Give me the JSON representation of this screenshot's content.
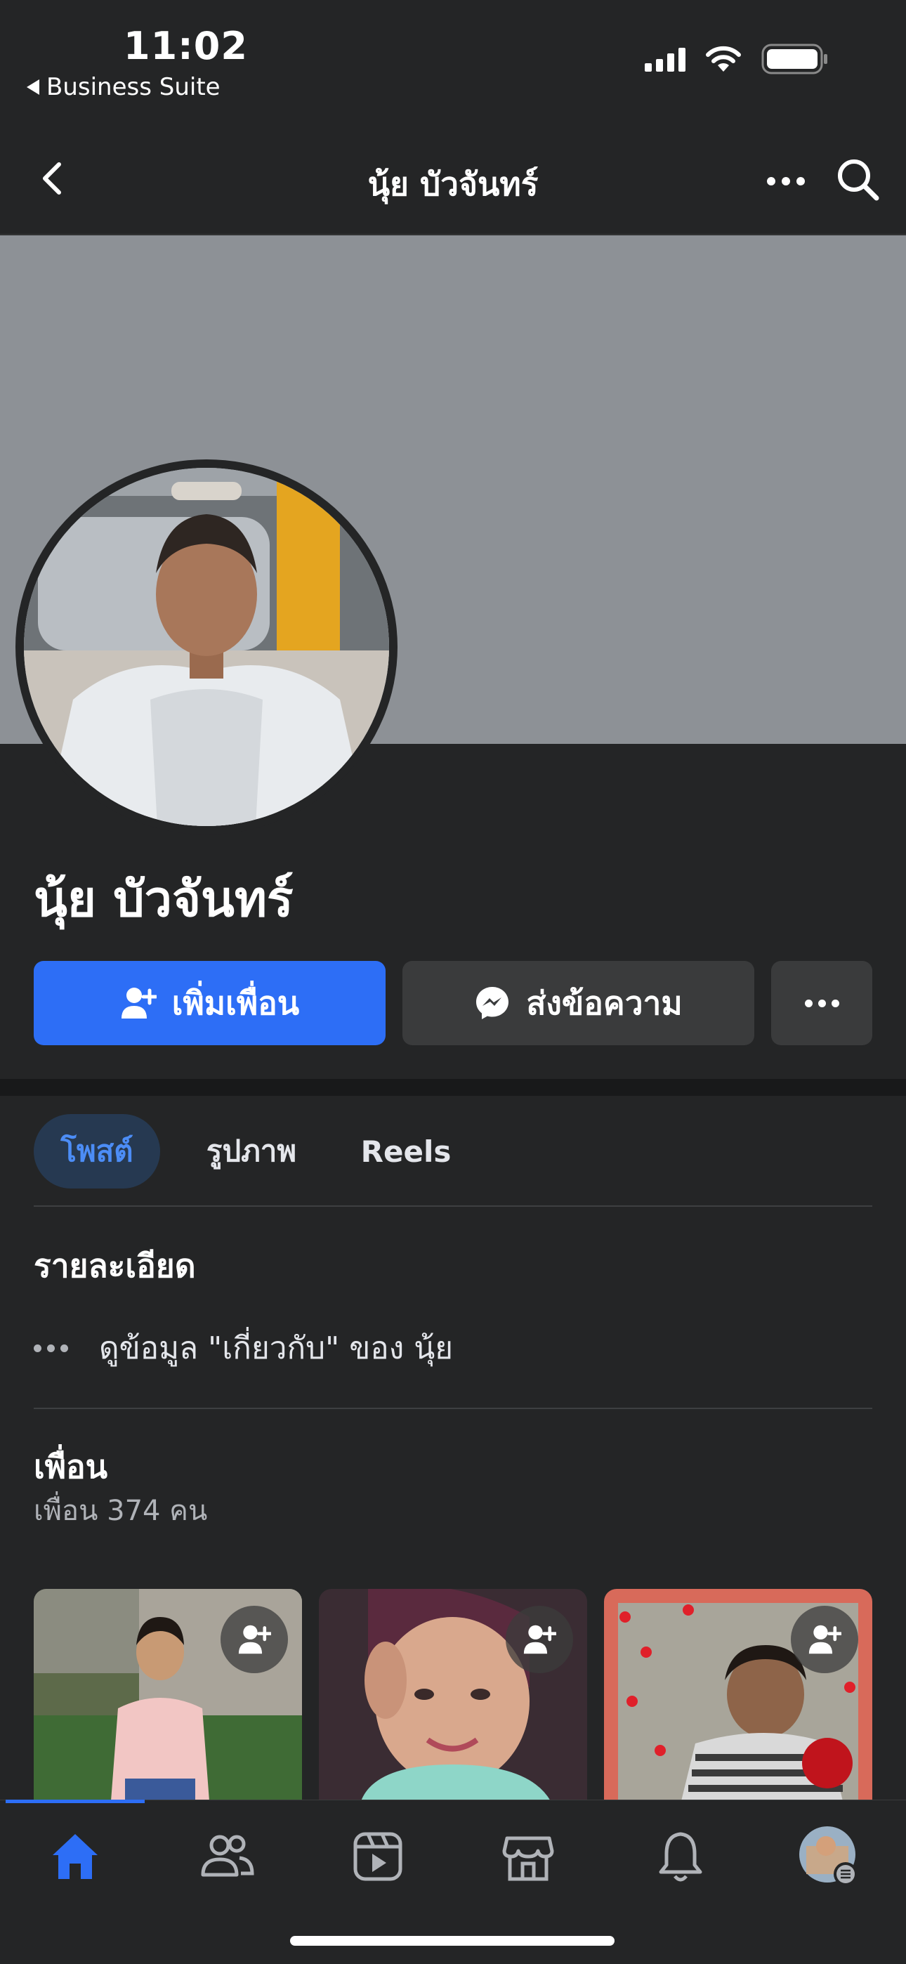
{
  "status_bar": {
    "time": "11:02",
    "back_app": "Business Suite",
    "icons": [
      "cellular-signal-icon",
      "wifi-icon",
      "battery-icon"
    ]
  },
  "header": {
    "title": "นุ้ย บัวจันทร์",
    "icons": [
      "chevron-left-icon",
      "more-icon",
      "search-icon"
    ]
  },
  "profile": {
    "name": "นุ้ย บัวจันทร์",
    "cover_color": "#8d9196"
  },
  "actions": {
    "add_friend": "เพิ่มเพื่อน",
    "message": "ส่งข้อความ",
    "more": "more-icon"
  },
  "tabs": [
    {
      "label": "โพสต์",
      "active": true
    },
    {
      "label": "รูปภาพ",
      "active": false
    },
    {
      "label": "Reels",
      "active": false
    }
  ],
  "details": {
    "title": "รายละเอียด",
    "about_link": "ดูข้อมูล \"เกี่ยวกับ\" ของ นุ้ย"
  },
  "friends": {
    "title": "เพื่อน",
    "count_text": "เพื่อน 374 คน",
    "cards": [
      {
        "icon": "add-friend-icon"
      },
      {
        "icon": "add-friend-icon"
      },
      {
        "icon": "add-friend-icon"
      }
    ]
  },
  "bottom_nav": {
    "items": [
      "home-icon",
      "friends-icon",
      "video-icon",
      "marketplace-icon",
      "notifications-icon",
      "profile-menu-icon"
    ],
    "active": "home-icon"
  },
  "colors": {
    "accent": "#2d6ef6",
    "background": "#242526",
    "tab_active_bg": "#263951"
  }
}
